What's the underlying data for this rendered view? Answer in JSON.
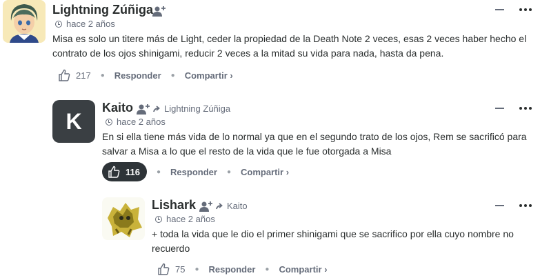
{
  "comments": [
    {
      "author": "Lightning Zúñiga",
      "time": "hace 2 años",
      "text": "Misa es solo un titere más de Light, ceder la propiedad de la Death Note 2 veces, esas 2 veces haber hecho el contrato de los ojos shinigami, reducir 2 veces a la mitad su vida para nada, hasta da pena.",
      "likes": "217",
      "reply_label": "Responder",
      "share_label": "Compartir ›"
    },
    {
      "author": "Kaito",
      "avatar_letter": "K",
      "reply_to": "Lightning Zúñiga",
      "time": "hace 2 años",
      "text": "En si ella tiene más vida de lo normal ya que en el segundo trato de los ojos, Rem se sacrificó para salvar a Misa a lo que el resto de la vida que le fue otorgada a Misa",
      "likes": "116",
      "reply_label": "Responder",
      "share_label": "Compartir ›"
    },
    {
      "author": "Lishark",
      "reply_to": "Kaito",
      "time": "hace 2 años",
      "text": "+ toda la vida que le dio el primer shinigami que se sacrifico por ella cuyo nombre no recuerdo",
      "likes": "75",
      "reply_label": "Responder",
      "share_label": "Compartir ›"
    }
  ],
  "icons": [
    "user-clock-icon",
    "follow-user-icon",
    "reply-arrow-icon",
    "thumbs-up-icon",
    "collapse-icon",
    "more-options-icon"
  ],
  "colors": {
    "text": "#2a2e2e",
    "muted": "#656c7a",
    "active_vote_bg": "#2e3438",
    "kaito_avatar_bg": "#3a3f43"
  }
}
